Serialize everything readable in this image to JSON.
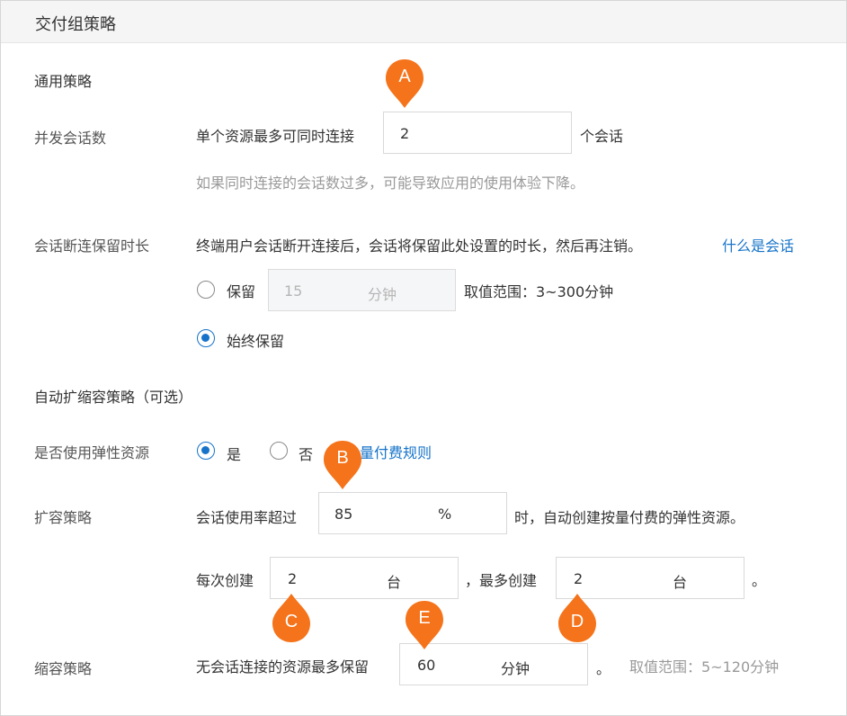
{
  "header": {
    "title": "交付组策略"
  },
  "general": {
    "section_title": "通用策略",
    "concurrent": {
      "label": "并发会话数",
      "prefix": "单个资源最多可同时连接",
      "value": "2",
      "suffix": "个会话",
      "hint": "如果同时连接的会话数过多，可能导致应用的使用体验下降。"
    },
    "retention": {
      "label": "会话断连保留时长",
      "desc": "终端用户会话断开连接后，会话将保留此处设置的时长，然后再注销。",
      "link": "什么是会话",
      "option_keep": "保留",
      "keep_value": "15",
      "keep_unit": "分钟",
      "range": "取值范围：3~300分钟",
      "option_always": "始终保留",
      "selected": "always"
    }
  },
  "autoscale": {
    "section_title": "自动扩缩容策略（可选）",
    "elastic": {
      "label": "是否使用弹性资源",
      "option_yes": "是",
      "option_no": "否",
      "link": "量付费规则",
      "selected": "yes"
    },
    "scale_out": {
      "label": "扩容策略",
      "prefix": "会话使用率超过",
      "value": "85",
      "unit": "%",
      "suffix": "时，自动创建按量付费的弹性资源。",
      "each_label": "每次创建",
      "each_value": "2",
      "each_unit": "台",
      "max_label": "，最多创建",
      "max_value": "2",
      "max_unit": "台",
      "end": "。"
    },
    "scale_in": {
      "label": "缩容策略",
      "prefix": "无会话连接的资源最多保留",
      "value": "60",
      "unit": "分钟",
      "end": "。",
      "range": "取值范围：5~120分钟"
    }
  },
  "markers": [
    "A",
    "B",
    "C",
    "D",
    "E"
  ],
  "colors": {
    "marker": "#f5731a",
    "link": "#1673c9",
    "radio": "#1673c9"
  }
}
